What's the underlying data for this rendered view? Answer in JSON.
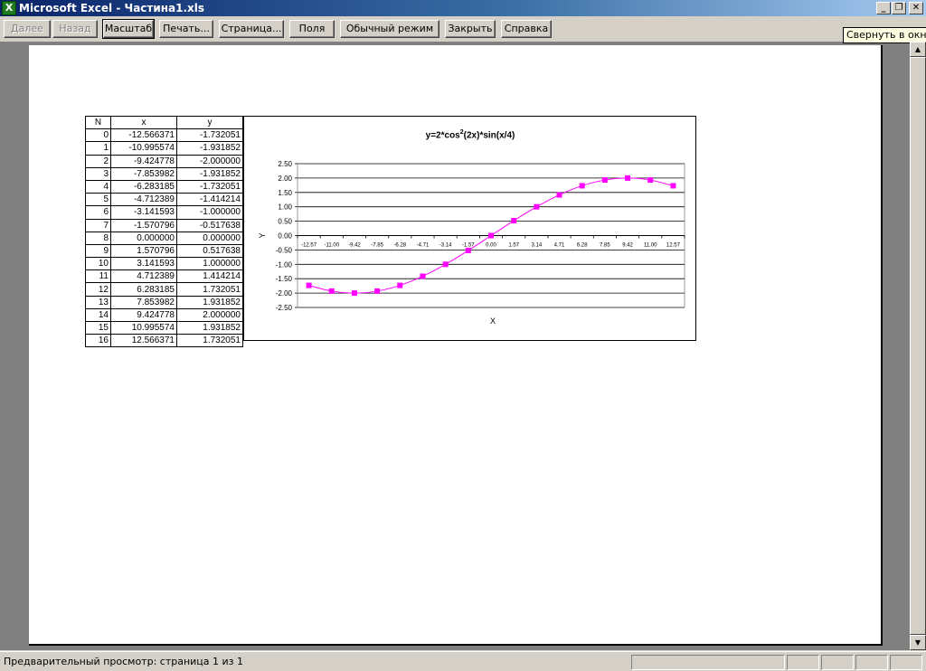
{
  "window": {
    "title": "Microsoft Excel - Частина1.xls",
    "icon": "X",
    "min_glyph": "_",
    "max_glyph": "❐",
    "close_glyph": "✕"
  },
  "toolbar": {
    "next": "Далее",
    "prev": "Назад",
    "zoom": "Масштаб",
    "print": "Печать...",
    "setup": "Страница...",
    "margins": "Поля",
    "normal_view": "Обычный режим",
    "close": "Закрыть",
    "help": "Справка"
  },
  "tooltip": "Свернуть в окно",
  "table": {
    "headers": [
      "N",
      "x",
      "y"
    ],
    "rows": [
      [
        "0",
        "-12.566371",
        "-1.732051"
      ],
      [
        "1",
        "-10.995574",
        "-1.931852"
      ],
      [
        "2",
        "-9.424778",
        "-2.000000"
      ],
      [
        "3",
        "-7.853982",
        "-1.931852"
      ],
      [
        "4",
        "-6.283185",
        "-1.732051"
      ],
      [
        "5",
        "-4.712389",
        "-1.414214"
      ],
      [
        "6",
        "-3.141593",
        "-1.000000"
      ],
      [
        "7",
        "-1.570796",
        "-0.517638"
      ],
      [
        "8",
        "0.000000",
        "0.000000"
      ],
      [
        "9",
        "1.570796",
        "0.517638"
      ],
      [
        "10",
        "3.141593",
        "1.000000"
      ],
      [
        "11",
        "4.712389",
        "1.414214"
      ],
      [
        "12",
        "6.283185",
        "1.732051"
      ],
      [
        "13",
        "7.853982",
        "1.931852"
      ],
      [
        "14",
        "9.424778",
        "2.000000"
      ],
      [
        "15",
        "10.995574",
        "1.931852"
      ],
      [
        "16",
        "12.566371",
        "1.732051"
      ]
    ]
  },
  "chart_data": {
    "type": "line",
    "title_main": "y=2*cos",
    "title_sup": "2",
    "title_rest": "(2x)*sin(x/4)",
    "xlabel": "X",
    "ylabel": "Y",
    "categories": [
      "-12.57",
      "-11.00",
      "-9.42",
      "-7.85",
      "-6.28",
      "-4.71",
      "-3.14",
      "-1.57",
      "0.00",
      "1.57",
      "3.14",
      "4.71",
      "6.28",
      "7.85",
      "9.42",
      "11.00",
      "12.57"
    ],
    "values": [
      -1.732051,
      -1.931852,
      -2.0,
      -1.931852,
      -1.732051,
      -1.414214,
      -1.0,
      -0.517638,
      0.0,
      0.517638,
      1.0,
      1.414214,
      1.732051,
      1.931852,
      2.0,
      1.931852,
      1.732051
    ],
    "yticks": [
      "2.50",
      "2.00",
      "1.50",
      "1.00",
      "0.50",
      "0.00",
      "-0.50",
      "-1.00",
      "-1.50",
      "-2.00",
      "-2.50"
    ],
    "ylim": [
      -2.5,
      2.5
    ],
    "grid": true,
    "legend": "none",
    "color": "#ff00ff"
  },
  "status": {
    "text": "Предварительный просмотр: страница 1 из 1"
  }
}
